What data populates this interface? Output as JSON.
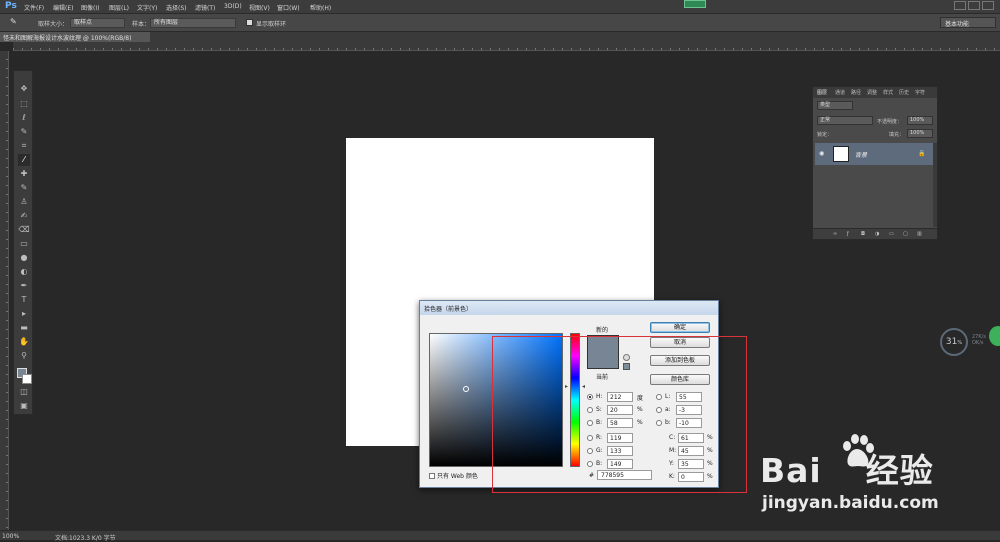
{
  "app": {
    "logo": "Ps",
    "menu": [
      "文件(F)",
      "编辑(E)",
      "图像(I)",
      "图层(L)",
      "文字(Y)",
      "选择(S)",
      "滤镜(T)",
      "3D(D)",
      "视图(V)",
      "窗口(W)",
      "帮助(H)"
    ]
  },
  "options": {
    "sample_size_label": "取样大小：",
    "sample_size_value": "取样点",
    "sample_label": "样本：",
    "sample_value": "所有图层",
    "show_ring_label": "显示取样环",
    "workspace": "基本功能"
  },
  "document": {
    "tab_title": "怪未和图解海报设计水波纹理 @ 100%(RGB/8)",
    "zoom": "100%",
    "info": "文档:1023.3 K/0 字节"
  },
  "layers_panel": {
    "tabs": [
      "图层",
      "通道",
      "路径",
      "调整",
      "样式",
      "历史",
      "字符"
    ],
    "filter_type": "类型",
    "blend_mode": "正常",
    "opacity_label": "不透明度：",
    "opacity_value": "100%",
    "lock_label": "锁定：",
    "fill_label": "填充：",
    "fill_value": "100%",
    "layer_name": "背景"
  },
  "picker": {
    "title": "拾色器（前景色）",
    "new_label": "新的",
    "current_label": "当前",
    "buttons": {
      "ok": "确定",
      "cancel": "取消",
      "add_swatch": "添加到色板",
      "libraries": "颜色库"
    },
    "hsb": [
      {
        "label": "H:",
        "value": "212",
        "unit": "度",
        "selected": true
      },
      {
        "label": "S:",
        "value": "20",
        "unit": "%",
        "selected": false
      },
      {
        "label": "B:",
        "value": "58",
        "unit": "%",
        "selected": false
      }
    ],
    "rgb": [
      {
        "label": "R:",
        "value": "119"
      },
      {
        "label": "G:",
        "value": "133"
      },
      {
        "label": "B:",
        "value": "149"
      }
    ],
    "lab": [
      {
        "label": "L:",
        "value": "55"
      },
      {
        "label": "a:",
        "value": "-3"
      },
      {
        "label": "b:",
        "value": "-10"
      }
    ],
    "cmyk": [
      {
        "label": "C:",
        "value": "61",
        "unit": "%"
      },
      {
        "label": "M:",
        "value": "45",
        "unit": "%"
      },
      {
        "label": "Y:",
        "value": "35",
        "unit": "%"
      },
      {
        "label": "K:",
        "value": "0",
        "unit": "%"
      }
    ],
    "web_only_label": "只有 Web 颜色",
    "hex_label": "#",
    "hex_value": "778595",
    "color": "#778595"
  },
  "overlay": {
    "speed_value": "31",
    "speed_unit": "%",
    "speed_sub_1": "27K/s",
    "speed_sub_2": "OK/s"
  },
  "watermark": {
    "brand_left": "Bai",
    "brand_right": "经验",
    "url": "jingyan.baidu.com"
  }
}
